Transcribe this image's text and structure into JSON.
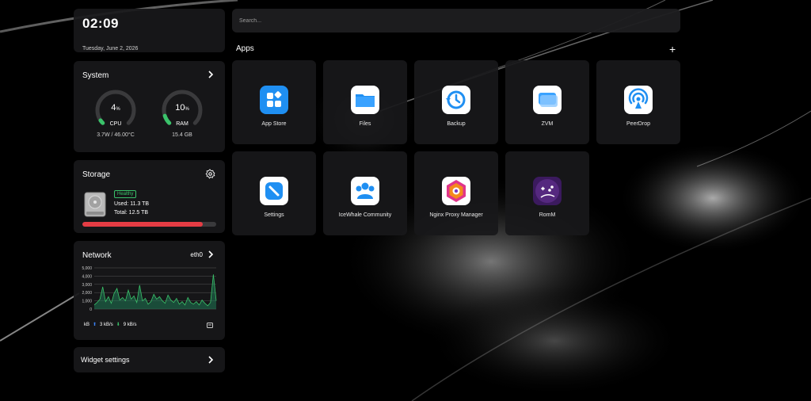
{
  "clock": {
    "time": "02:09",
    "date": "Tuesday, June 2, 2026"
  },
  "system": {
    "title": "System",
    "cpu": {
      "value": "4",
      "unit": "%",
      "label": "CPU",
      "percent": 4,
      "sub": "3.7W / 46.00°C"
    },
    "ram": {
      "value": "10",
      "unit": "%",
      "label": "RAM",
      "percent": 10,
      "sub": "15.4 GB"
    }
  },
  "storage": {
    "title": "Storage",
    "status": "Healthy",
    "used": "Used: 11.3 TB",
    "total": "Total: 12.5 TB",
    "used_fraction": 0.9
  },
  "network": {
    "title": "Network",
    "interface": "eth0",
    "y_ticks": [
      "5,000",
      "4,000",
      "3,000",
      "2,000",
      "1,000",
      "0"
    ],
    "unit": "kB",
    "up": "3 kB/s",
    "down": "9 kB/s"
  },
  "widget_settings": {
    "label": "Widget settings"
  },
  "search": {
    "placeholder": "Search..."
  },
  "apps": {
    "title": "Apps",
    "add": "+",
    "items": [
      {
        "name": "App Store",
        "icon": "app-store-icon"
      },
      {
        "name": "Files",
        "icon": "files-icon"
      },
      {
        "name": "Backup",
        "icon": "backup-icon"
      },
      {
        "name": "ZVM",
        "icon": "zvm-icon"
      },
      {
        "name": "PeerDrop",
        "icon": "peerdrop-icon"
      },
      {
        "name": "Settings",
        "icon": "settings-icon"
      },
      {
        "name": "IceWhale Community",
        "icon": "community-icon"
      },
      {
        "name": "Nginx Proxy Manager",
        "icon": "nginx-proxy-manager-icon"
      },
      {
        "name": "RomM",
        "icon": "romm-icon"
      }
    ]
  },
  "colors": {
    "accent_green": "#3ac26a",
    "storage_red": "#e53c44",
    "upload_blue": "#3b82f6"
  }
}
